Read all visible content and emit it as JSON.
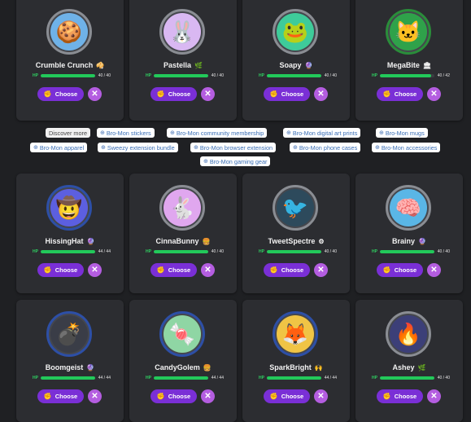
{
  "cards": [
    {
      "name": "Crumble Crunch",
      "badge": "🥠",
      "hp": "40 / 40",
      "hp_label": "HP",
      "hp_fraction": 1.0,
      "choose": "Choose",
      "close": "✕",
      "avatar_emoji": "🍪",
      "avatar_bg": "#6fb2e8",
      "ring": "#8a8d93"
    },
    {
      "name": "Pastella",
      "badge": "🌿",
      "hp": "40 / 40",
      "hp_label": "HP",
      "hp_fraction": 1.0,
      "choose": "Choose",
      "close": "✕",
      "avatar_emoji": "🐰",
      "avatar_bg": "#d9b8f2",
      "ring": "#8a8d93"
    },
    {
      "name": "Soapy",
      "badge": "🔮",
      "hp": "40 / 40",
      "hp_label": "HP",
      "hp_fraction": 1.0,
      "choose": "Choose",
      "close": "✕",
      "avatar_emoji": "🐸",
      "avatar_bg": "#3ecb9a",
      "ring": "#8a8d93"
    },
    {
      "name": "MegaBite",
      "badge": "🏛",
      "hp": "40 / 42",
      "hp_label": "HP",
      "hp_fraction": 0.95,
      "choose": "Choose",
      "close": "✕",
      "avatar_emoji": "🐱",
      "avatar_bg": "#2fa24a",
      "ring": "#2a8d3a"
    },
    {
      "name": "HissingHat",
      "badge": "🔮",
      "hp": "44 / 44",
      "hp_label": "HP",
      "hp_fraction": 1.0,
      "choose": "Choose",
      "close": "✕",
      "avatar_emoji": "🤠",
      "avatar_bg": "#5c5fe0",
      "ring": "#2d4fa6"
    },
    {
      "name": "CinnaBunny",
      "badge": "🍔",
      "hp": "40 / 40",
      "hp_label": "HP",
      "hp_fraction": 1.0,
      "choose": "Choose",
      "close": "✕",
      "avatar_emoji": "🐇",
      "avatar_bg": "#e0a7ef",
      "ring": "#8a8d93"
    },
    {
      "name": "TweetSpectre",
      "badge": "⚙",
      "hp": "40 / 40",
      "hp_label": "HP",
      "hp_fraction": 1.0,
      "choose": "Choose",
      "close": "✕",
      "avatar_emoji": "🐦",
      "avatar_bg": "#2d4a5c",
      "ring": "#8a8d93"
    },
    {
      "name": "Brainy",
      "badge": "🔮",
      "hp": "40 / 40",
      "hp_label": "HP",
      "hp_fraction": 1.0,
      "choose": "Choose",
      "close": "✕",
      "avatar_emoji": "🧠",
      "avatar_bg": "#5ab6e6",
      "ring": "#8a8d93"
    },
    {
      "name": "Boomgeist",
      "badge": "🔮",
      "hp": "44 / 44",
      "hp_label": "HP",
      "hp_fraction": 1.0,
      "choose": "Choose",
      "close": "✕",
      "avatar_emoji": "💣",
      "avatar_bg": "#3a3d47",
      "ring": "#2d4fa6"
    },
    {
      "name": "CandyGolem",
      "badge": "🍔",
      "hp": "44 / 44",
      "hp_label": "HP",
      "hp_fraction": 1.0,
      "choose": "Choose",
      "close": "✕",
      "avatar_emoji": "🍬",
      "avatar_bg": "#8fd6a4",
      "ring": "#2d4fa6"
    },
    {
      "name": "SparkBright",
      "badge": "🙌",
      "hp": "44 / 44",
      "hp_label": "HP",
      "hp_fraction": 1.0,
      "choose": "Choose",
      "close": "✕",
      "avatar_emoji": "🦊",
      "avatar_bg": "#f0c445",
      "ring": "#2d4fa6"
    },
    {
      "name": "Ashey",
      "badge": "🌿",
      "hp": "40 / 40",
      "hp_label": "HP",
      "hp_fraction": 1.0,
      "choose": "Choose",
      "close": "✕",
      "avatar_emoji": "🔥",
      "avatar_bg": "#3c3f78",
      "ring": "#8a8d93"
    }
  ],
  "discover": {
    "label": "Discover more",
    "pills": [
      "Bro-Mon stickers",
      "Bro-Mon community membership",
      "Bro-Mon digital art prints",
      "Bro-Mon mugs",
      "Bro-Mon apparel",
      "Sweezy extension bundle",
      "Bro-Mon browser extension",
      "Bro-Mon phone cases",
      "Bro-Mon accessories",
      "Bro-Mon gaming gear"
    ],
    "pill_icon": "circle-plus-icon"
  },
  "colors": {
    "background": "#1f2023",
    "card": "#2c2d31",
    "hp_fill": "#22c95a",
    "choose_button": "#7a2fd6",
    "close_button": "#b45de0",
    "pill_text": "#3b6fb6"
  }
}
